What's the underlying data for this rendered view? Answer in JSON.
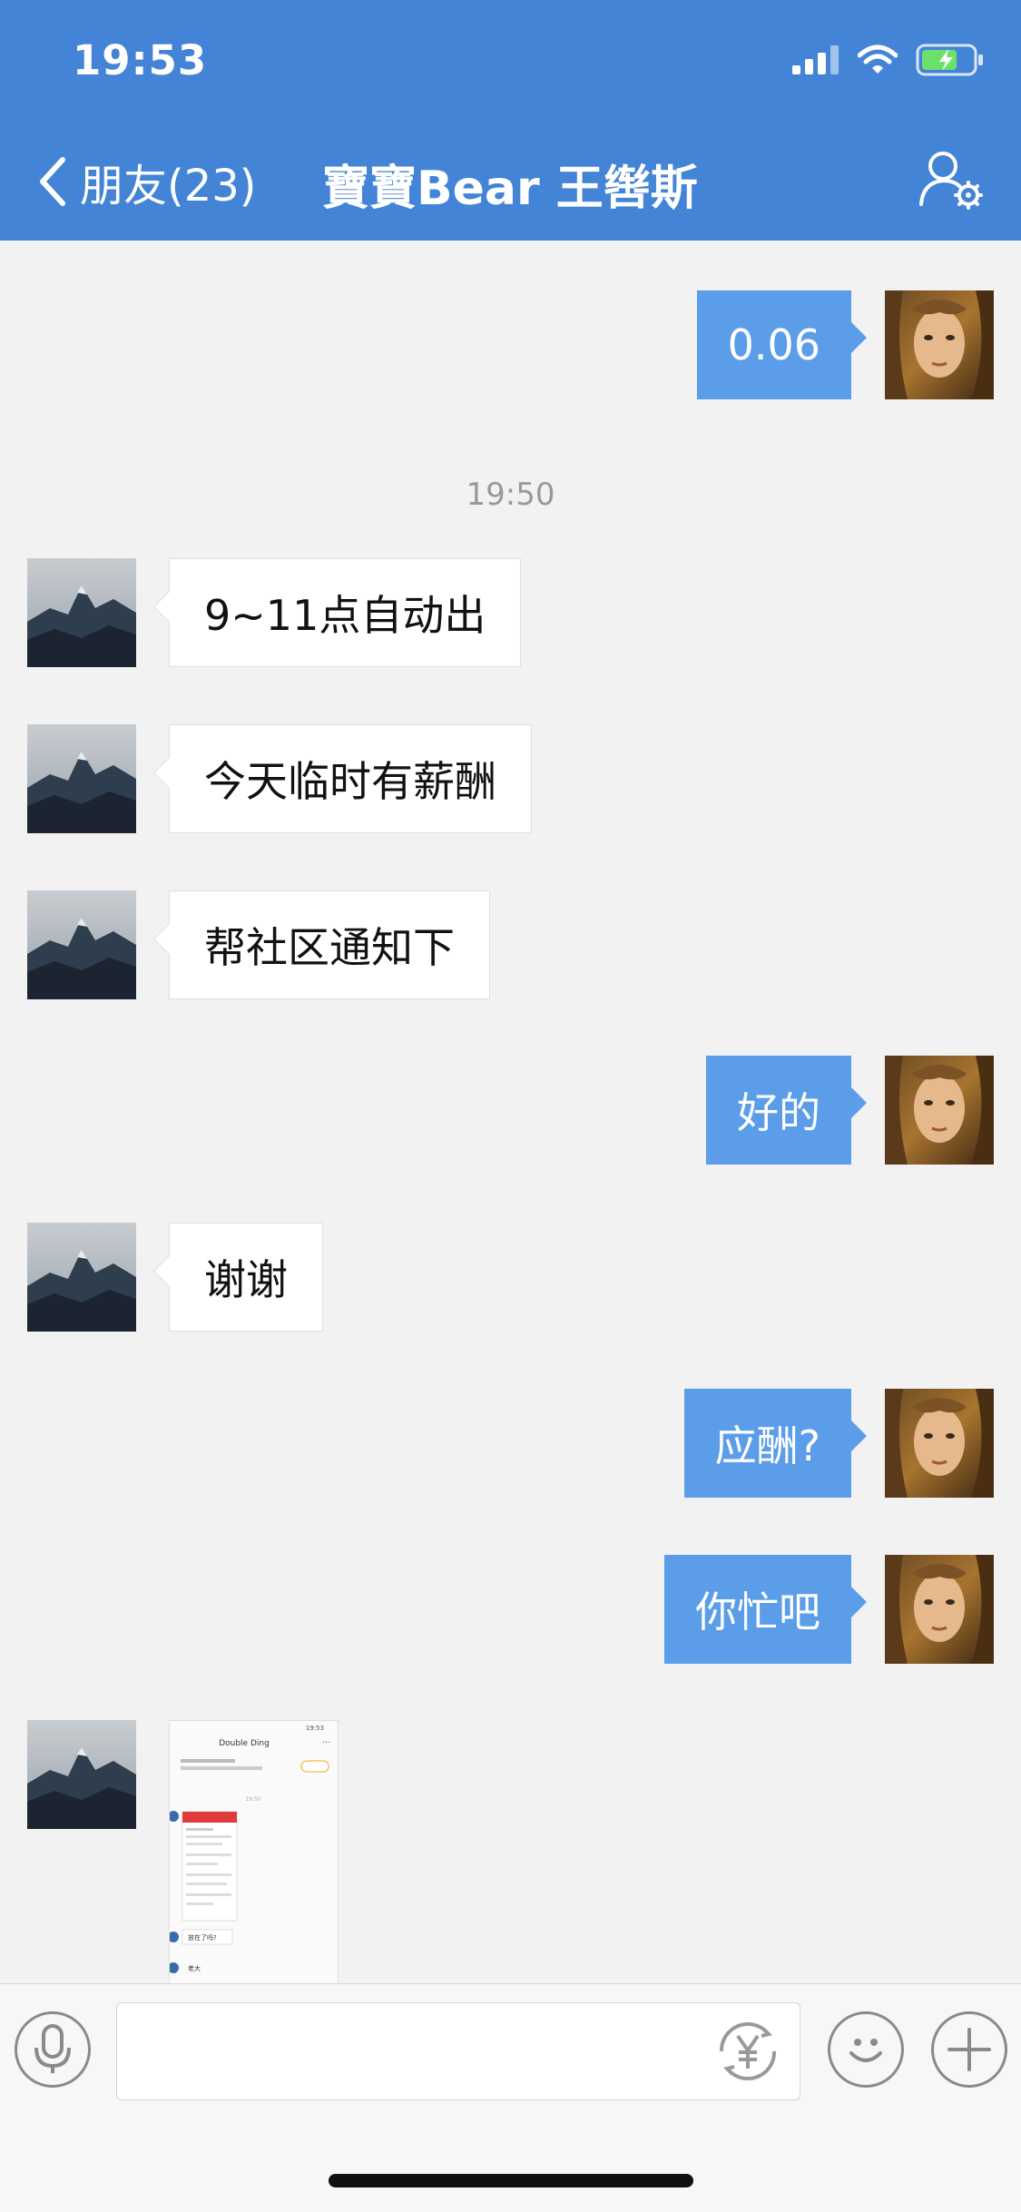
{
  "status_bar": {
    "time": "19:53"
  },
  "header": {
    "back_label": "朋友(23)",
    "title": "寶寶Bear  王辔斯"
  },
  "messages": [
    {
      "side": "out",
      "text": "0.06"
    },
    {
      "side": "time",
      "text": "19:50"
    },
    {
      "side": "in",
      "text": "9~11点自动出"
    },
    {
      "side": "in",
      "text": "今天临时有薪酬"
    },
    {
      "side": "in",
      "text": "帮社区通知下"
    },
    {
      "side": "out",
      "text": "好的"
    },
    {
      "side": "in",
      "text": "谢谢"
    },
    {
      "side": "out",
      "text": "应酬?"
    },
    {
      "side": "out",
      "text": "你忙吧"
    },
    {
      "side": "in",
      "type": "image"
    }
  ],
  "shared_image": {
    "status": "19:53",
    "title": "Double Ding",
    "time": "19:50",
    "reply1": "放在了吗?",
    "reply2": "老大"
  },
  "input": {
    "placeholder": ""
  },
  "colors": {
    "header": "#4384d6",
    "outgoing_bubble": "#5b9de9",
    "background": "#f2f2f2"
  },
  "icons": [
    "chevron-left-icon",
    "signal-icon",
    "wifi-icon",
    "battery-icon",
    "profile-settings-icon",
    "microphone-icon",
    "yuan-icon",
    "emoji-icon",
    "plus-icon"
  ]
}
